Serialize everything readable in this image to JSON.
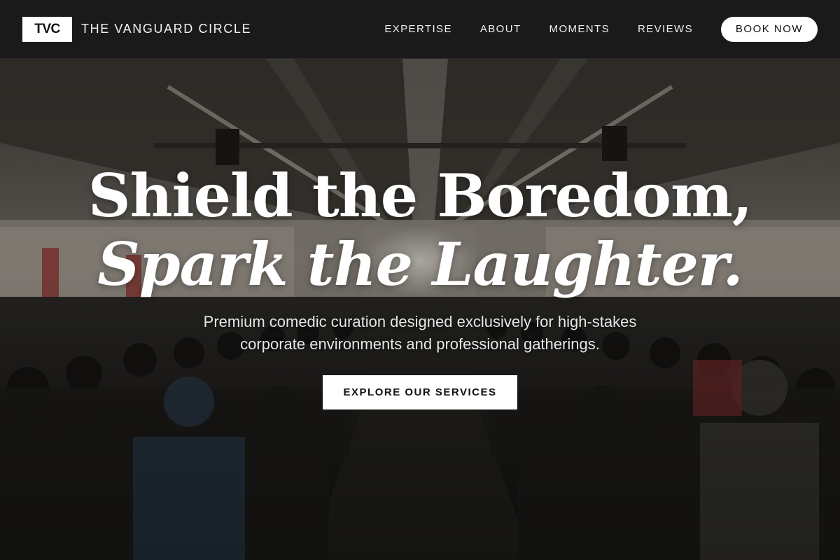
{
  "header": {
    "logo_text": "TVC",
    "brand_name": "THE VANGUARD CIRCLE",
    "nav_items": [
      "EXPERTISE",
      "ABOUT",
      "MOMENTS",
      "REVIEWS"
    ],
    "cta_label": "BOOK NOW"
  },
  "hero": {
    "headline_line1": "Shield the Boredom,",
    "headline_line2": "Spark the Laughter.",
    "subtext": "Premium comedic curation designed exclusively for high-stakes corporate environments and professional gatherings.",
    "cta_label": "EXPLORE OUR SERVICES",
    "background_image": "conference-audience-photo"
  },
  "colors": {
    "header_bg": "#1a1a1a",
    "button_bg": "#ffffff",
    "button_text": "#111111",
    "text_primary": "#ffffff"
  }
}
